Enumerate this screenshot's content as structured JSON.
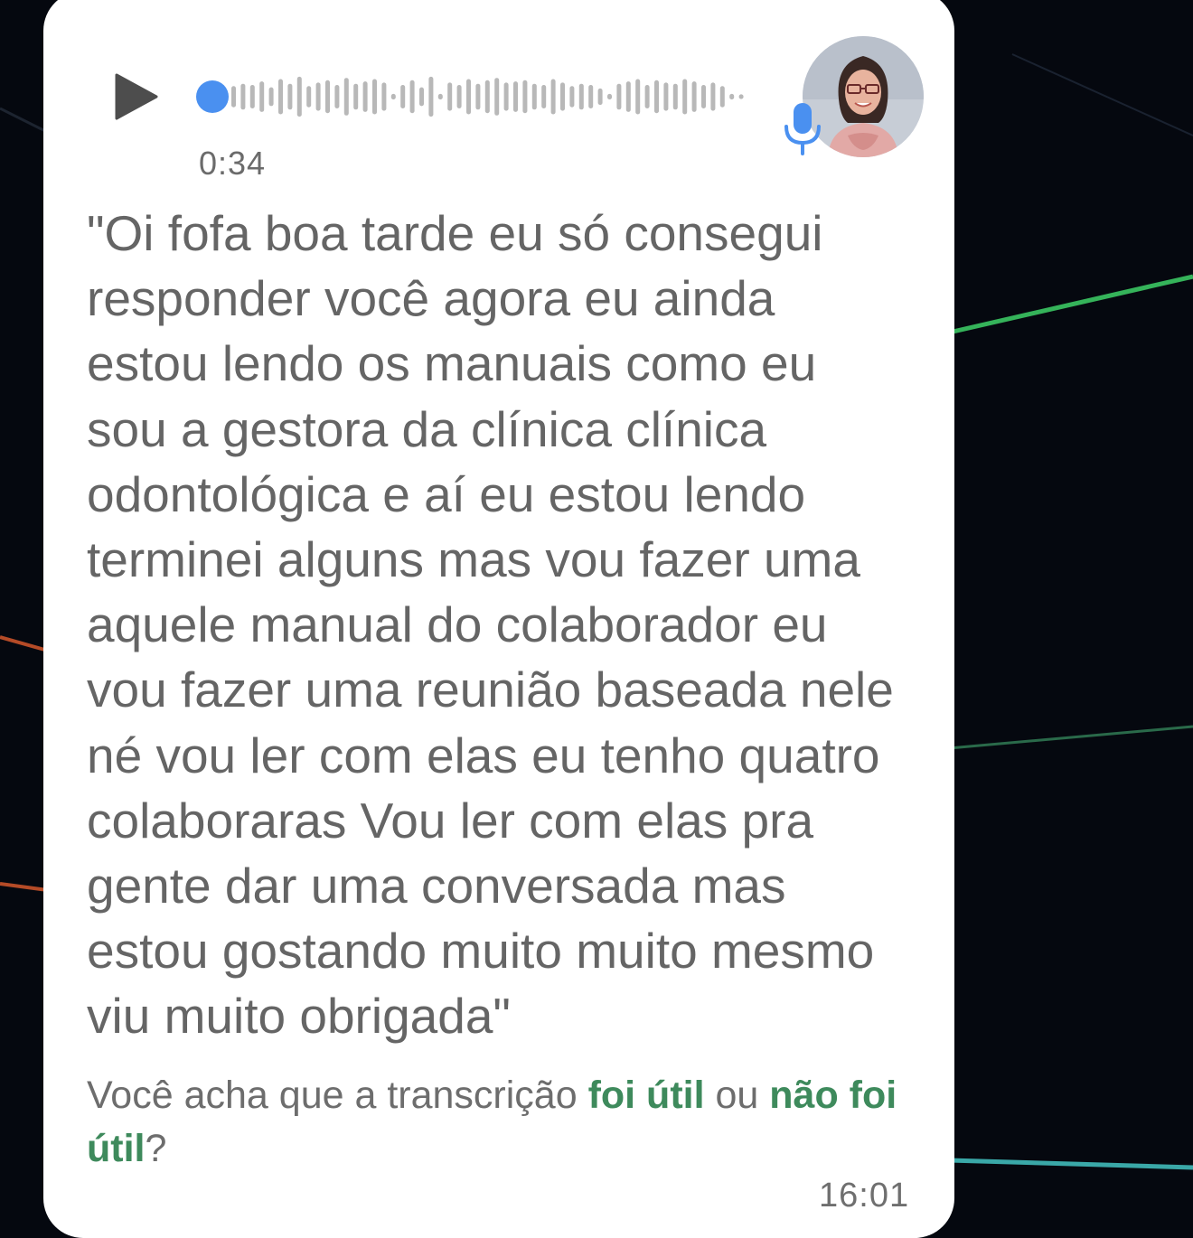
{
  "message": {
    "duration": "0:34",
    "transcript": "\"Oi fofa boa tarde eu só consegui\nresponder você agora eu ainda\nestou lendo os manuais como eu\nsou a gestora da clínica clínica\nodontológica e aí eu estou lendo\nterminei alguns mas vou fazer uma\naquele manual do colaborador eu\nvou fazer uma reunião baseada nele\nné vou ler com elas eu tenho quatro\ncolaboraras Vou ler com elas pra\ngente dar uma conversada mas\nestou gostando muito muito mesmo\nviu muito obrigada\"",
    "timestamp": "16:01",
    "playback_progress": 0
  },
  "feedback": {
    "prefix": "Você acha que a transcrição ",
    "useful_label": "foi útil",
    "middle": " ou ",
    "not_useful_label": "não foi útil",
    "suffix": "?"
  },
  "icons": {
    "play": "play-icon",
    "mic": "microphone-icon",
    "avatar": "sender-avatar"
  },
  "colors": {
    "bubble": "#ffffff",
    "text": "#656565",
    "link": "#3e8a5c",
    "accent": "#4a90f0",
    "waveform": "#b8b8b8",
    "background": "#05080f"
  }
}
